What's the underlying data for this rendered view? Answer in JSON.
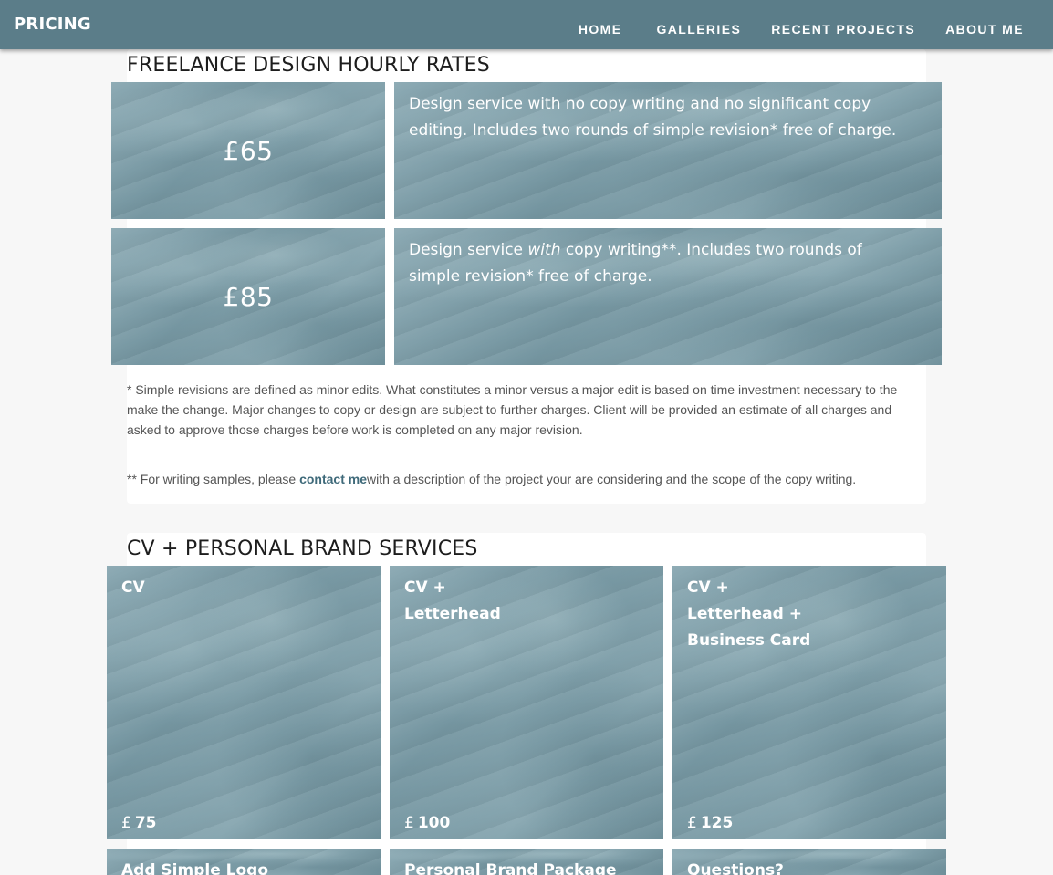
{
  "header": {
    "title": "PRICING",
    "nav": [
      "HOME",
      "GALLERIES",
      "RECENT PROJECTS",
      "ABOUT ME"
    ]
  },
  "hourly": {
    "heading": "FREELANCE DESIGN HOURLY RATES",
    "rates": [
      {
        "price": "£65",
        "description": "Design service with no copy writing and no significant copy editing. Includes two rounds of simple revision* free of charge."
      },
      {
        "price": "£85",
        "desc_before": "Design service ",
        "desc_emph": "with",
        "desc_after": " copy writing**. Includes two rounds of simple revision* free of charge."
      }
    ],
    "note_revisions": "* Simple revisions are defined as minor edits. What constitutes a minor versus a major edit is based on time investment necessary to the make the change. Major changes to copy or design are subject to further charges. Client will be provided an estimate of all charges and asked to approve those charges before work is completed on any major revision.",
    "note_writing_prefix": "** For writing samples, please ",
    "note_writing_link": "contact me",
    "note_writing_suffix": "with a description of the project your are considering and the scope of the copy writing."
  },
  "cv": {
    "heading": "CV + PERSONAL BRAND SERVICES",
    "cards": [
      {
        "lines": [
          "CV"
        ],
        "currency": "£",
        "amount": "75"
      },
      {
        "lines": [
          "CV +",
          "Letterhead"
        ],
        "currency": "£",
        "amount": "100"
      },
      {
        "lines": [
          "CV +",
          "Letterhead +",
          "Business Card"
        ],
        "currency": "£",
        "amount": "125"
      }
    ],
    "more_cards": [
      "Add Simple Logo",
      "Personal Brand Package",
      "Questions?"
    ]
  },
  "colors": {
    "header_bg": "#5b7d89",
    "accent_link": "#3f6a7a",
    "card_tint": "#7e9ea9"
  }
}
